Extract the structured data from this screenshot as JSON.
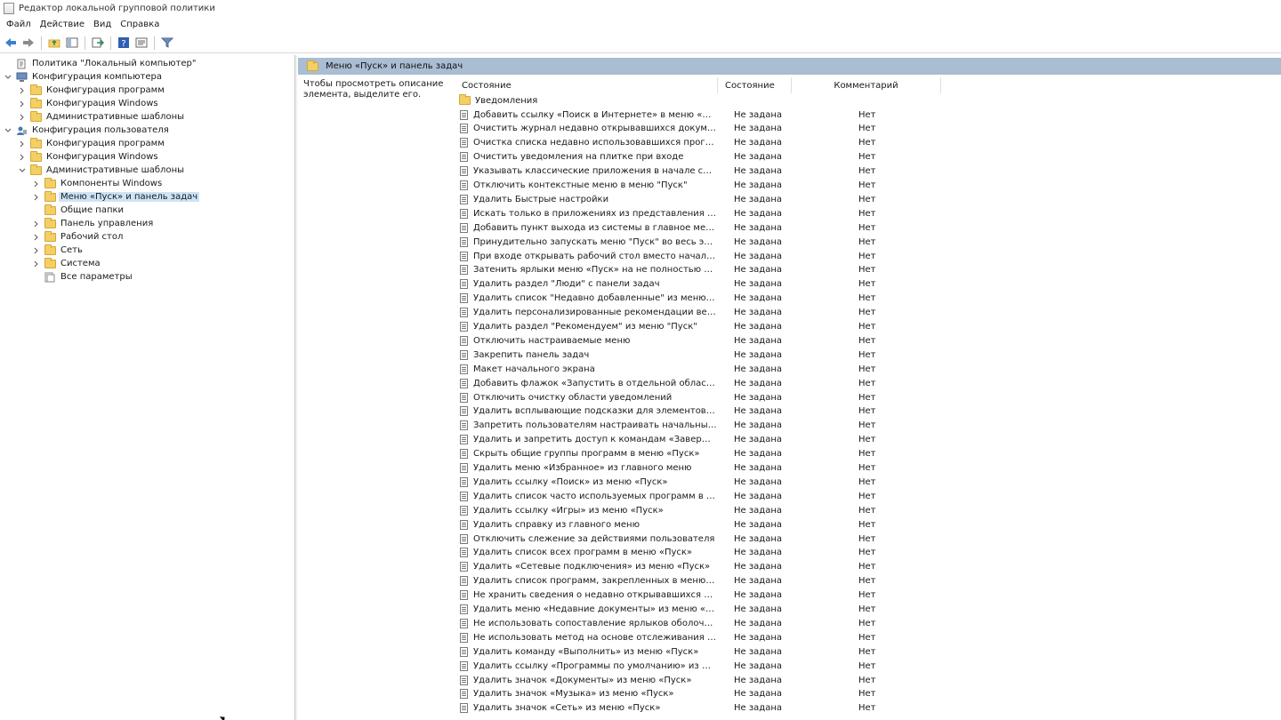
{
  "window": {
    "title": "Редактор локальной групповой политики",
    "icon": "gpedit-icon"
  },
  "menu": [
    "Файл",
    "Действие",
    "Вид",
    "Справка"
  ],
  "toolbar": [
    {
      "name": "back-arrow-icon"
    },
    {
      "name": "forward-arrow-icon"
    },
    {
      "name": "up-folder-icon"
    },
    {
      "name": "show-hide-tree-icon"
    },
    {
      "name": "export-list-icon"
    },
    {
      "name": "help-icon"
    },
    {
      "name": "properties-icon"
    },
    {
      "name": "filter-icon"
    }
  ],
  "tree": [
    {
      "label": "Политика \"Локальный компьютер\"",
      "icon": "computer-policy-icon",
      "expander": ""
    },
    {
      "label": "Конфигурация компьютера",
      "icon": "computer-icon",
      "expander": "v"
    },
    {
      "label": "Конфигурация программ",
      "icon": "folder-icon",
      "expander": ">"
    },
    {
      "label": "Конфигурация Windows",
      "icon": "folder-icon",
      "expander": ">"
    },
    {
      "label": "Административные шаблоны",
      "icon": "folder-icon",
      "expander": ">"
    },
    {
      "label": "Конфигурация пользователя",
      "icon": "user-icon",
      "expander": "v"
    },
    {
      "label": "Конфигурация программ",
      "icon": "folder-icon",
      "expander": ">"
    },
    {
      "label": "Конфигурация Windows",
      "icon": "folder-icon",
      "expander": ">"
    },
    {
      "label": "Административные шаблоны",
      "icon": "folder-icon",
      "expander": "v"
    },
    {
      "label": "Компоненты Windows",
      "icon": "folder-icon",
      "expander": ">"
    },
    {
      "label": "Меню «Пуск» и панель задач",
      "icon": "folder-icon",
      "expander": ">",
      "selected": true
    },
    {
      "label": "Общие папки",
      "icon": "folder-icon",
      "expander": ""
    },
    {
      "label": "Панель управления",
      "icon": "folder-icon",
      "expander": ">"
    },
    {
      "label": "Рабочий стол",
      "icon": "folder-icon",
      "expander": ">"
    },
    {
      "label": "Сеть",
      "icon": "folder-icon",
      "expander": ">"
    },
    {
      "label": "Система",
      "icon": "folder-icon",
      "expander": ">"
    },
    {
      "label": "Все параметры",
      "icon": "all-settings-icon",
      "expander": ""
    }
  ],
  "details": {
    "header": "Меню «Пуск» и панель задач",
    "description": "Чтобы просмотреть описание элемента, выделите его.",
    "columns": [
      "Состояние",
      "Состояние",
      "Комментарий"
    ],
    "folder_row": "Уведомления",
    "rows": [
      [
        "Добавить ссылку «Поиск в Интернете» в меню «Пуск»",
        "Не задана",
        "Нет"
      ],
      [
        "Очистить журнал недавно открывавшихся документов п...",
        "Не задана",
        "Нет"
      ],
      [
        "Очистка списка недавно использовавшихся программ д...",
        "Не задана",
        "Нет"
      ],
      [
        "Очистить уведомления на плитке при входе",
        "Не задана",
        "Нет"
      ],
      [
        "Указывать классические приложения в начале списка в ...",
        "Не задана",
        "Нет"
      ],
      [
        "Отключить контекстные меню в меню \"Пуск\"",
        "Не задана",
        "Нет"
      ],
      [
        "Удалить Быстрые настройки",
        "Не задана",
        "Нет"
      ],
      [
        "Искать только в приложениях из представления «Прило...",
        "Не задана",
        "Нет"
      ],
      [
        "Добавить пункт выхода из системы в главное меню",
        "Не задана",
        "Нет"
      ],
      [
        "Принудительно запускать меню \"Пуск\" во весь экран ил...",
        "Не задана",
        "Нет"
      ],
      [
        "При входе открывать рабочий стол вместо начального э...",
        "Не задана",
        "Нет"
      ],
      [
        "Затенить ярлыки меню «Пуск» на не полностью установ...",
        "Не задана",
        "Нет"
      ],
      [
        "Удалить раздел \"Люди\" с панели задач",
        "Не задана",
        "Нет"
      ],
      [
        "Удалить список \"Недавно добавленные\" из меню \"Пуск\"",
        "Не задана",
        "Нет"
      ],
      [
        "Удалить персонализированные рекомендации веб-сайто...",
        "Не задана",
        "Нет"
      ],
      [
        "Удалить раздел \"Рекомендуем\" из меню \"Пуск\"",
        "Не задана",
        "Нет"
      ],
      [
        "Отключить настраиваемые меню",
        "Не задана",
        "Нет"
      ],
      [
        "Закрепить панель задач",
        "Не задана",
        "Нет"
      ],
      [
        "Макет начального экрана",
        "Не задана",
        "Нет"
      ],
      [
        "Добавить флажок «Запустить в отдельной области памят...",
        "Не задана",
        "Нет"
      ],
      [
        "Отключить очистку области уведомлений",
        "Не задана",
        "Нет"
      ],
      [
        "Удалить всплывающие подсказки для элементов главног...",
        "Не задана",
        "Нет"
      ],
      [
        "Запретить пользователям настраивать начальный экран",
        "Не задана",
        "Нет"
      ],
      [
        "Удалить и запретить доступ к командам «Завершение ра...",
        "Не задана",
        "Нет"
      ],
      [
        "Скрыть общие группы программ в меню «Пуск»",
        "Не задана",
        "Нет"
      ],
      [
        "Удалить меню «Избранное» из главного меню",
        "Не задана",
        "Нет"
      ],
      [
        "Удалить ссылку «Поиск» из меню «Пуск»",
        "Не задана",
        "Нет"
      ],
      [
        "Удалить список часто используемых программ в меню «...",
        "Не задана",
        "Нет"
      ],
      [
        "Удалить ссылку «Игры» из меню «Пуск»",
        "Не задана",
        "Нет"
      ],
      [
        "Удалить справку из главного меню",
        "Не задана",
        "Нет"
      ],
      [
        "Отключить слежение за действиями пользователя",
        "Не задана",
        "Нет"
      ],
      [
        "Удалить список всех программ в меню «Пуск»",
        "Не задана",
        "Нет"
      ],
      [
        "Удалить «Сетевые подключения» из меню «Пуск»",
        "Не задана",
        "Нет"
      ],
      [
        "Удалить список программ, закрепленных в меню «Пуск»",
        "Не задана",
        "Нет"
      ],
      [
        "Не хранить сведения о недавно открывавшихся докумен...",
        "Не задана",
        "Нет"
      ],
      [
        "Удалить меню «Недавние документы» из меню «Пуск»",
        "Не задана",
        "Нет"
      ],
      [
        "Не использовать сопоставление ярлыков оболочки на о...",
        "Не задана",
        "Нет"
      ],
      [
        "Не использовать метод на основе отслеживания для соп...",
        "Не задана",
        "Нет"
      ],
      [
        "Удалить команду «Выполнить» из меню «Пуск»",
        "Не задана",
        "Нет"
      ],
      [
        "Удалить ссылку «Программы по умолчанию» из меню «...",
        "Не задана",
        "Нет"
      ],
      [
        "Удалить значок «Документы» из меню «Пуск»",
        "Не задана",
        "Нет"
      ],
      [
        "Удалить значок «Музыка» из меню «Пуск»",
        "Не задана",
        "Нет"
      ],
      [
        "Удалить значок «Сеть» из меню «Пуск»",
        "Не задана",
        "Нет"
      ]
    ]
  }
}
